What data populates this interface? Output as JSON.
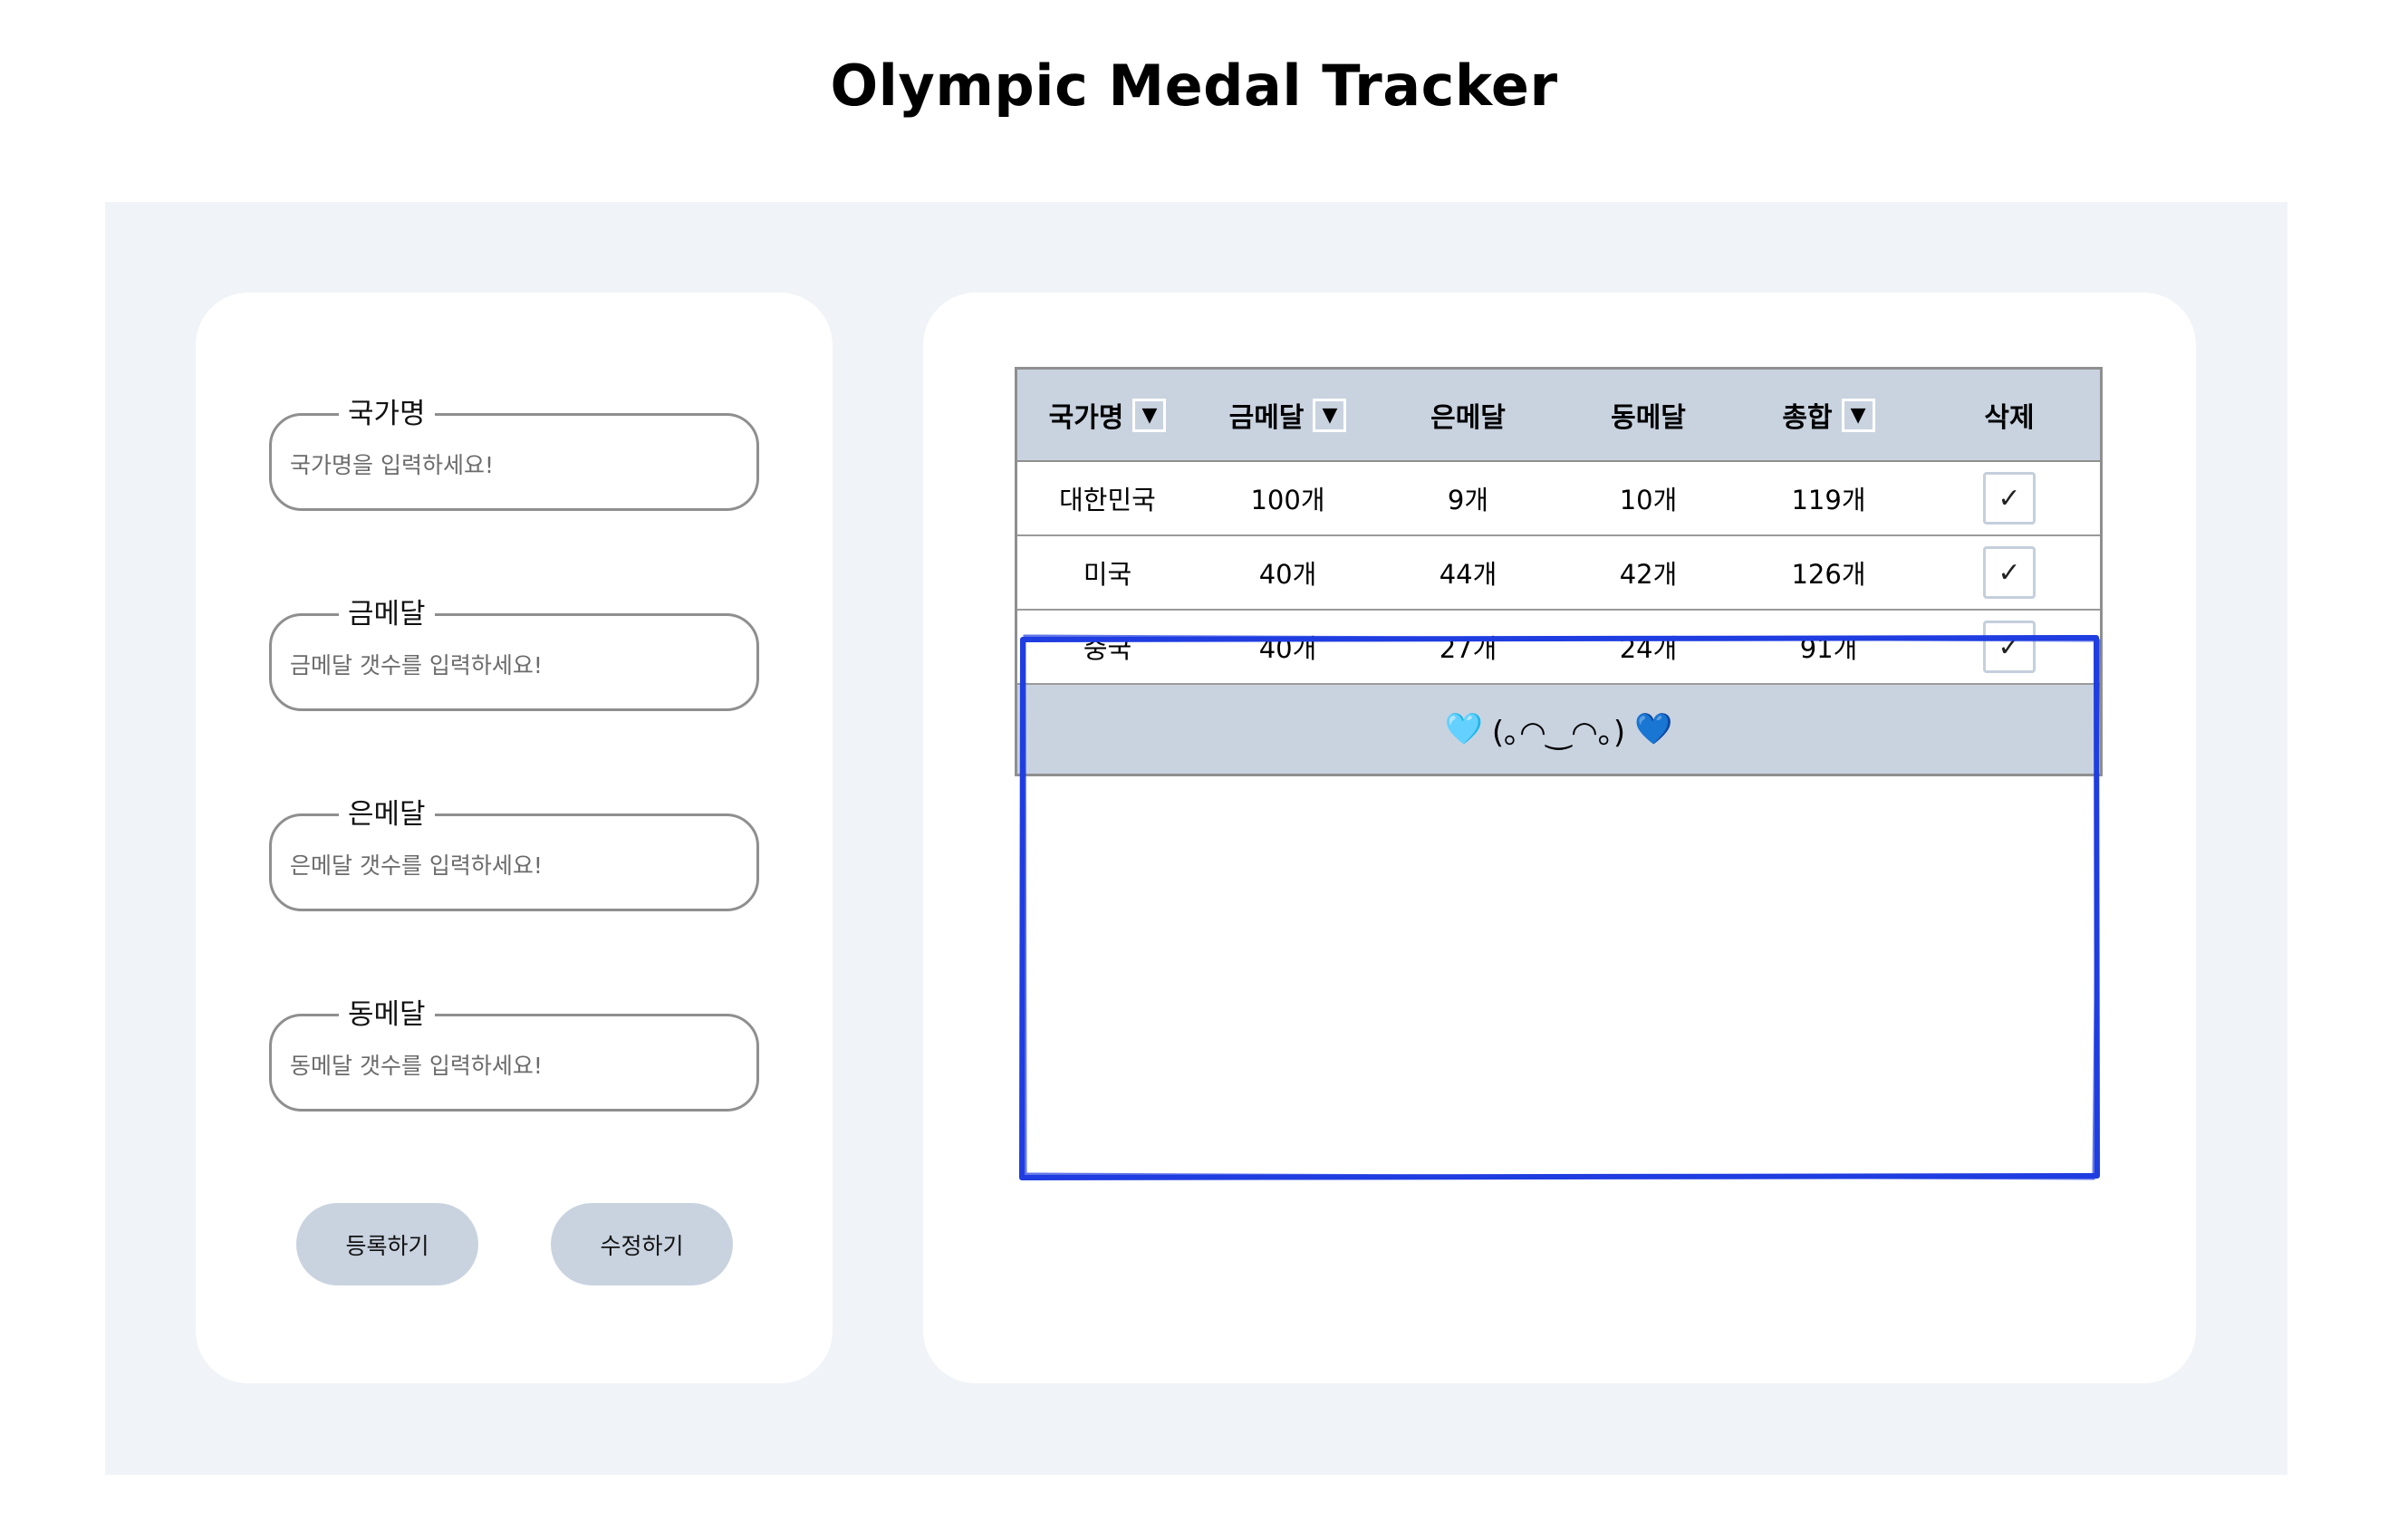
{
  "title": "Olympic Medal Tracker",
  "form": {
    "fields": [
      {
        "label": "국가명",
        "placeholder": "국가명을 입력하세요!"
      },
      {
        "label": "금메달",
        "placeholder": "금메달 갯수를 입력하세요!"
      },
      {
        "label": "은메달",
        "placeholder": "은메달 갯수를 입력하세요!"
      },
      {
        "label": "동메달",
        "placeholder": "동메달 갯수를 입력하세요!"
      }
    ],
    "register_label": "등록하기",
    "edit_label": "수정하기"
  },
  "table": {
    "headers": [
      "국가명",
      "금메달",
      "은메달",
      "동메달",
      "총합",
      "삭제"
    ],
    "sort_icon": "▼",
    "rows": [
      {
        "country": "대한민국",
        "gold": "100개",
        "silver": "9개",
        "bronze": "10개",
        "total": "119개",
        "delete": "✓"
      },
      {
        "country": "미국",
        "gold": "40개",
        "silver": "44개",
        "bronze": "42개",
        "total": "126개",
        "delete": "✓"
      },
      {
        "country": "중국",
        "gold": "40개",
        "silver": "27개",
        "bronze": "24개",
        "total": "91개",
        "delete": "✓"
      }
    ],
    "footer": {
      "left_heart": "🩵",
      "face": "(｡◠‿◠｡)",
      "right_heart": "💙"
    }
  },
  "colors": {
    "accent": "#c9d3e0",
    "background": "#f0f3f7",
    "annotation": "#1f3de0"
  }
}
